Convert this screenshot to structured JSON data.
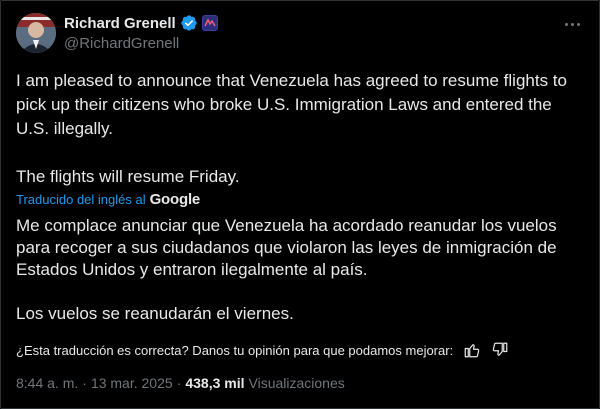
{
  "author": {
    "name": "Richard Grenell",
    "handle": "@RichardGrenell"
  },
  "tweet": {
    "paragraphs": [
      "I am pleased to announce that Venezuela has agreed to resume flights to pick up their citizens who broke U.S. Immigration Laws and entered the U.S. illegally.",
      "The flights will resume Friday."
    ]
  },
  "translation": {
    "label": "Traducido del inglés al",
    "provider": "Google",
    "paragraphs": [
      "Me complace anunciar que Venezuela ha acordado reanudar los vuelos para recoger a sus ciudadanos que violaron las leyes de inmigración de Estados Unidos y entraron ilegalmente al país.",
      "Los vuelos se reanudarán el viernes."
    ],
    "feedback_prompt": "¿Esta traducción es correcta? Danos tu opinión para que podamos mejorar:"
  },
  "meta": {
    "time": "8:44 a. m.",
    "separator": "·",
    "date": "13 mar. 2025",
    "views_count": "438,3 mil",
    "views_label": "Visualizaciones"
  },
  "icons": {
    "verified": "verified-badge-icon",
    "affiliation": "affiliation-badge-icon",
    "more": "more-options-icon",
    "thumbs_up": "thumbs-up-icon",
    "thumbs_down": "thumbs-down-icon"
  },
  "colors": {
    "background": "#000000",
    "text": "#e7e9ea",
    "secondary": "#71767b",
    "link": "#1d9bf0",
    "verified": "#1d9bf0"
  }
}
